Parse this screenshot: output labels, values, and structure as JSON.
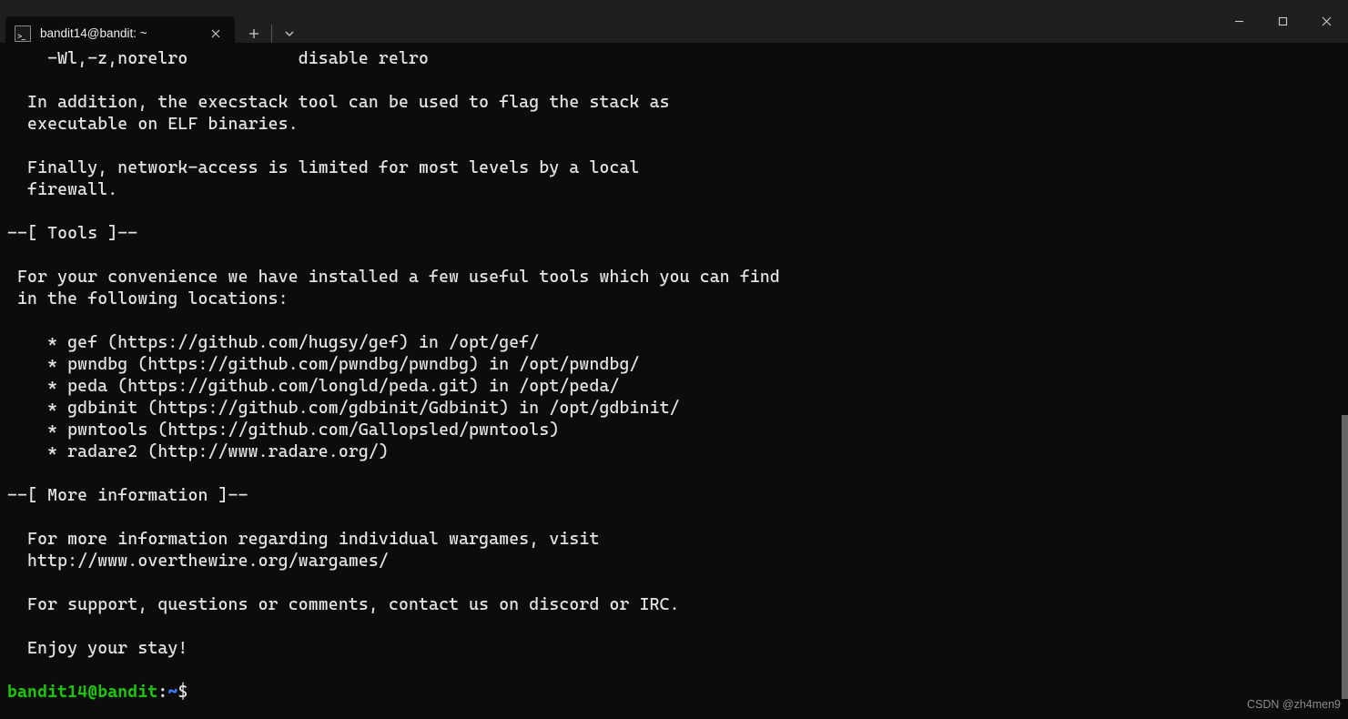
{
  "titlebar": {
    "tab_title": "bandit14@bandit: ~"
  },
  "terminal": {
    "lines": [
      "    -Wl,-z,norelro           disable relro",
      "",
      "  In addition, the execstack tool can be used to flag the stack as",
      "  executable on ELF binaries.",
      "",
      "  Finally, network-access is limited for most levels by a local",
      "  firewall.",
      "",
      "--[ Tools ]--",
      "",
      " For your convenience we have installed a few useful tools which you can find",
      " in the following locations:",
      "",
      "    * gef (https://github.com/hugsy/gef) in /opt/gef/",
      "    * pwndbg (https://github.com/pwndbg/pwndbg) in /opt/pwndbg/",
      "    * peda (https://github.com/longld/peda.git) in /opt/peda/",
      "    * gdbinit (https://github.com/gdbinit/Gdbinit) in /opt/gdbinit/",
      "    * pwntools (https://github.com/Gallopsled/pwntools)",
      "    * radare2 (http://www.radare.org/)",
      "",
      "--[ More information ]--",
      "",
      "  For more information regarding individual wargames, visit",
      "  http://www.overthewire.org/wargames/",
      "",
      "  For support, questions or comments, contact us on discord or IRC.",
      "",
      "  Enjoy your stay!",
      ""
    ],
    "prompt": {
      "user_host": "bandit14@bandit",
      "colon": ":",
      "path": "~",
      "symbol": "$"
    }
  },
  "watermark": "CSDN @zh4men9"
}
